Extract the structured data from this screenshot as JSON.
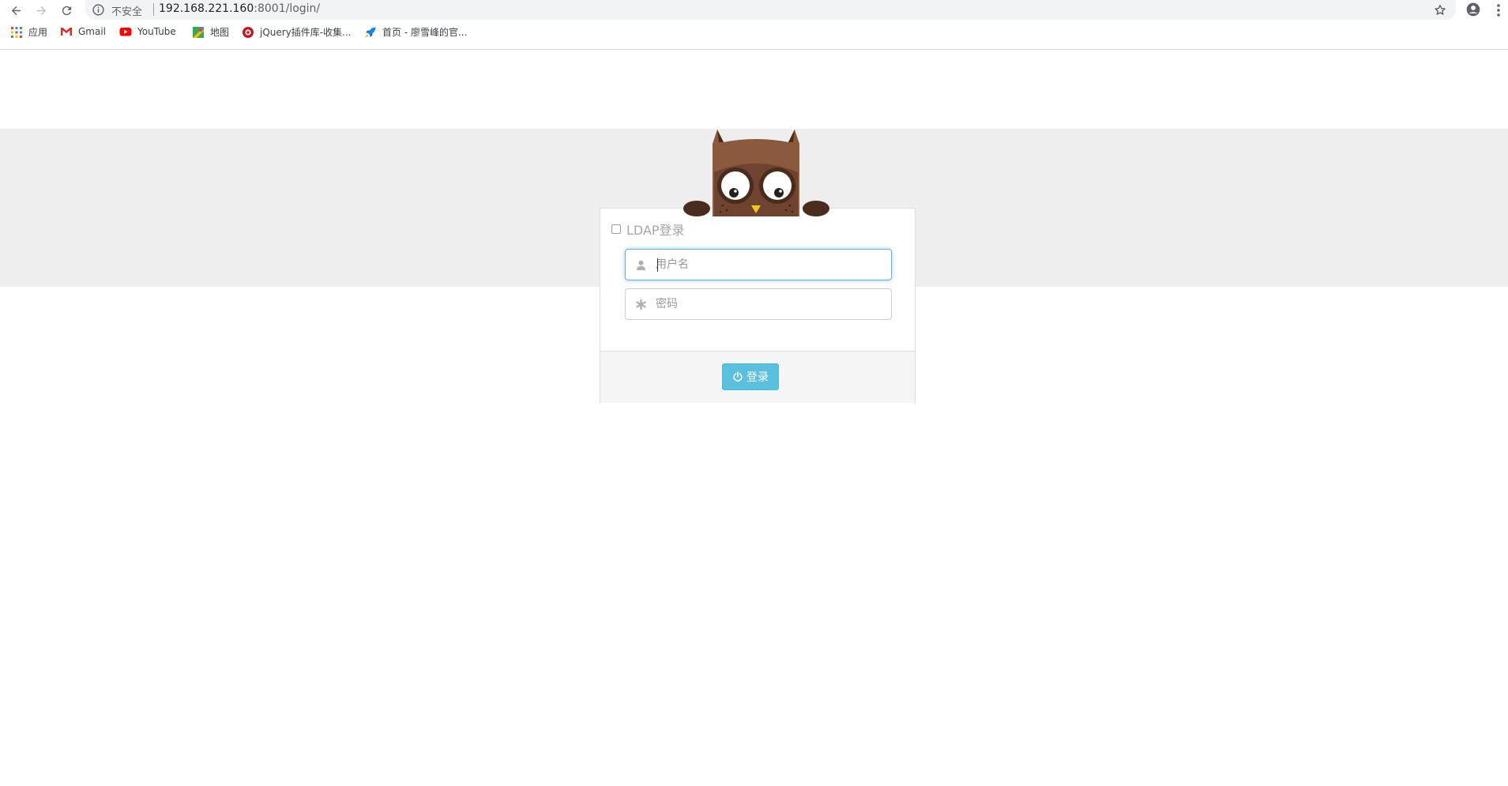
{
  "browser": {
    "security_label": "不安全",
    "url_host": "192.168.221.160",
    "url_rest": ":8001/login/",
    "nav_icons": [
      "back-icon",
      "forward-icon",
      "reload-icon"
    ],
    "bookmarks": [
      {
        "label": "应用",
        "icon": "apps-grid-icon"
      },
      {
        "label": "Gmail",
        "icon": "gmail-icon"
      },
      {
        "label": "YouTube",
        "icon": "youtube-icon"
      },
      {
        "label": "地图",
        "icon": "maps-icon"
      },
      {
        "label": "jQuery插件库-收集...",
        "icon": "jquery-plugin-icon"
      },
      {
        "label": "首页 - 廖雪峰的官...",
        "icon": "rocket-icon"
      }
    ]
  },
  "login": {
    "ldap_label": "LDAP登录",
    "username_placeholder": "用户名",
    "password_placeholder": "密码",
    "submit_label": "登录"
  },
  "colors": {
    "accent": "#5bc0de",
    "band": "#eeeeee",
    "owl_body": "#8b5a3c",
    "owl_dark": "#4a2c1d",
    "focus_border": "#66afe9"
  }
}
